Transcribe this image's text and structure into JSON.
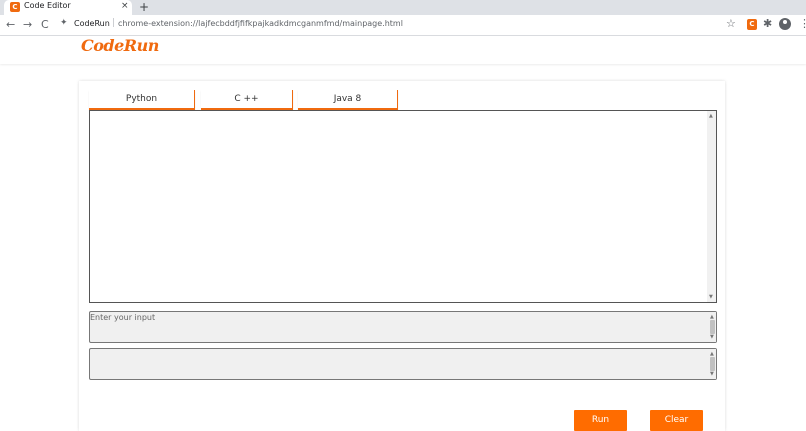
{
  "browser": {
    "tab_title": "Code Editor",
    "tab_favicon_letter": "C",
    "tab_close": "×",
    "new_tab": "+",
    "site_name": "CodeRun",
    "url": "chrome-extension://lajfecbddfjfifkpajkadkdmcganmfmd/mainpage.html",
    "separator": "|",
    "back": "←",
    "forward": "→",
    "reload": "C",
    "accent": "#f06a0f"
  },
  "app": {
    "logo": "CodeRun",
    "accent": "#ff6c00"
  },
  "tabs": [
    {
      "label": "Python"
    },
    {
      "label": "C ++"
    },
    {
      "label": "Java 8"
    }
  ],
  "editor": {
    "value": ""
  },
  "input": {
    "placeholder": "Enter your input",
    "value": ""
  },
  "output": {
    "value": ""
  },
  "buttons": {
    "run": "Run",
    "clear": "Clear"
  }
}
